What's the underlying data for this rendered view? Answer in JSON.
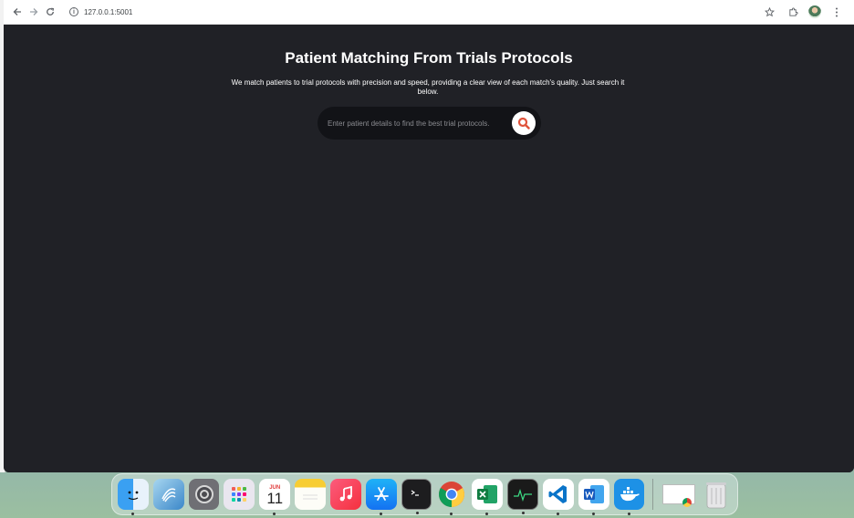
{
  "browser": {
    "url": "127.0.0.1:5001"
  },
  "page": {
    "title": "Patient Matching From Trials Protocols",
    "subtitle": "We match patients to trial protocols with precision and speed, providing a clear view of each match's quality. Just search it below.",
    "search": {
      "placeholder": "Enter patient details to find the best trial protocols.",
      "value": ""
    }
  },
  "dock": {
    "calendar_month": "JUN",
    "calendar_day": "11",
    "apps": [
      "finder",
      "copilot",
      "system-settings",
      "launchpad",
      "calendar",
      "notes",
      "music",
      "app-store",
      "terminal",
      "chrome",
      "excel",
      "activity-monitor",
      "vscode",
      "word",
      "docker",
      "chrome-window",
      "trash"
    ]
  },
  "colors": {
    "page_bg": "#202126",
    "search_bg": "#121317",
    "search_icon": "#e0523a"
  }
}
